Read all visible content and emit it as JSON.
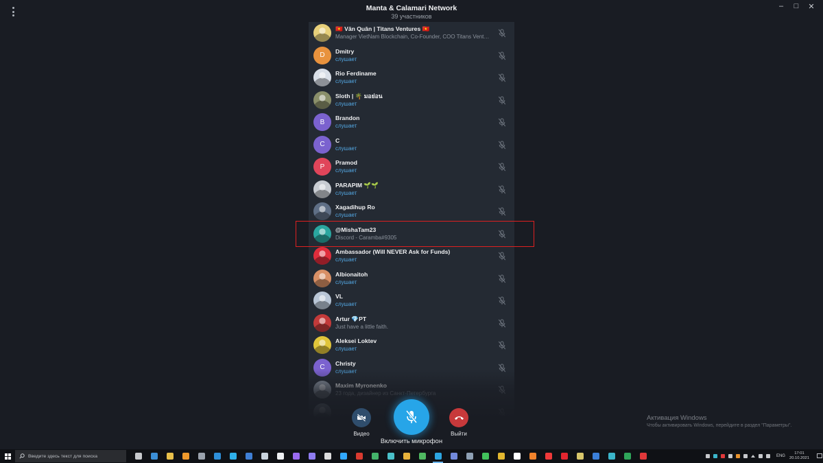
{
  "window": {
    "title": "Manta & Calamari Network",
    "subtitle": "39 участников",
    "controls": {
      "minimize": "–",
      "maximize": "□",
      "close": "✕"
    }
  },
  "participants": [
    {
      "name": "🇻🇳 Văn Quân | Titans Ventures 🇻🇳",
      "status": "Manager VietNam Blockchain, Co-Founder, COO Titans Ventures",
      "status_type": "about",
      "avatar_color": "#e7d07a",
      "avatar_letter": "",
      "photo": true
    },
    {
      "name": "Dmitry",
      "status": "слушает",
      "status_type": "listen",
      "avatar_color": "#e8923d",
      "avatar_letter": "D",
      "photo": false
    },
    {
      "name": "Rio Ferdiname",
      "status": "слушает",
      "status_type": "listen",
      "avatar_color": "#d9dfe8",
      "avatar_letter": "",
      "photo": true
    },
    {
      "name": "Sloth | 🌴 มอย่อน",
      "status": "слушает",
      "status_type": "listen",
      "avatar_color": "#8a8f6a",
      "avatar_letter": "",
      "photo": true
    },
    {
      "name": "Brandon",
      "status": "слушает",
      "status_type": "listen",
      "avatar_color": "#7b62cf",
      "avatar_letter": "B",
      "photo": false
    },
    {
      "name": "C",
      "status": "слушает",
      "status_type": "listen",
      "avatar_color": "#7b62cf",
      "avatar_letter": "C",
      "photo": false
    },
    {
      "name": "Pramod",
      "status": "слушает",
      "status_type": "listen",
      "avatar_color": "#e0455a",
      "avatar_letter": "P",
      "photo": false
    },
    {
      "name": "PARAPIM 🌱🌱",
      "status": "слушает",
      "status_type": "listen",
      "avatar_color": "#c8ccd2",
      "avatar_letter": "",
      "photo": true
    },
    {
      "name": "Xagadihup Ro",
      "status": "слушает",
      "status_type": "listen",
      "avatar_color": "#5f6f86",
      "avatar_letter": "",
      "photo": true
    },
    {
      "name": "@MishaTam23",
      "status": "Discord - Caramba#9305",
      "status_type": "about",
      "avatar_color": "#2aa7a0",
      "avatar_letter": "",
      "photo": true
    },
    {
      "name": "Ambassador (Will NEVER Ask for Funds)",
      "status": "слушает",
      "status_type": "listen",
      "avatar_color": "#e02d3c",
      "avatar_letter": "",
      "photo": true
    },
    {
      "name": "Albionaitoh",
      "status": "слушает",
      "status_type": "listen",
      "avatar_color": "#d89066",
      "avatar_letter": "",
      "photo": true
    },
    {
      "name": "VL",
      "status": "слушает",
      "status_type": "listen",
      "avatar_color": "#b9c6d6",
      "avatar_letter": "",
      "photo": true
    },
    {
      "name": "Artur 💎PT",
      "status": "Just have a little faith.",
      "status_type": "about",
      "avatar_color": "#c33a3a",
      "avatar_letter": "",
      "photo": true
    },
    {
      "name": "Aleksei Loktev",
      "status": "слушает",
      "status_type": "listen",
      "avatar_color": "#e0c53a",
      "avatar_letter": "",
      "photo": true
    },
    {
      "name": "Christy",
      "status": "слушает",
      "status_type": "listen",
      "avatar_color": "#7b62cf",
      "avatar_letter": "C",
      "photo": false
    },
    {
      "name": "Maxim Myronenko",
      "status": "23 года, дизайнер из Санкт-Петербурга",
      "status_type": "about",
      "avatar_color": "#8d96a3",
      "avatar_letter": "",
      "photo": true
    },
    {
      "name": "",
      "status": "",
      "status_type": "about",
      "avatar_color": "#6f7884",
      "avatar_letter": "",
      "photo": true
    }
  ],
  "controls": {
    "video_label": "Видео",
    "mic_label": "Включить микрофон",
    "leave_label": "Выйти",
    "video_color": "#2f4d6c",
    "mic_color": "#27a5e8",
    "leave_color": "#c7393b"
  },
  "watermark": {
    "line1": "Активация Windows",
    "line2": "Чтобы активировать Windows, перейдите в раздел \"Параметры\"."
  },
  "taskbar": {
    "search_placeholder": "Введите здесь текст для поиска",
    "apps": [
      {
        "icon": "task-view-icon",
        "color": "#c7c9cc"
      },
      {
        "icon": "mail-icon",
        "color": "#3b8fd6"
      },
      {
        "icon": "file-explorer-icon",
        "color": "#e8c04a"
      },
      {
        "icon": "lightning-app-icon",
        "color": "#f09a2c"
      },
      {
        "icon": "calculator-icon",
        "color": "#9aa2ac"
      },
      {
        "icon": "edge-legacy-icon",
        "color": "#2e8fd8"
      },
      {
        "icon": "skype-icon",
        "color": "#2fb0ea"
      },
      {
        "icon": "save-app-icon",
        "color": "#3f7fd4"
      },
      {
        "icon": "sphere-app-icon",
        "color": "#c9d3dc"
      },
      {
        "icon": "capcut-icon",
        "color": "#eef0f2"
      },
      {
        "icon": "premiere-icon",
        "color": "#9b6bf0"
      },
      {
        "icon": "after-effects-icon",
        "color": "#8f7cf0"
      },
      {
        "icon": "ball-app-icon",
        "color": "#dcdcdc"
      },
      {
        "icon": "photoshop-icon",
        "color": "#31a8ff"
      },
      {
        "icon": "filezilla-icon",
        "color": "#d83a2f"
      },
      {
        "icon": "map-app-icon",
        "color": "#44b36a"
      },
      {
        "icon": "pen-app-icon",
        "color": "#4ac0c8"
      },
      {
        "icon": "sketch-app-icon",
        "color": "#e8b23b"
      },
      {
        "icon": "network-app-icon",
        "color": "#4fb860"
      },
      {
        "icon": "telegram-icon",
        "color": "#2ca5e0"
      },
      {
        "icon": "discord-icon",
        "color": "#7289da"
      },
      {
        "icon": "cube-app-icon",
        "color": "#8ea0b3"
      },
      {
        "icon": "whatsapp-icon",
        "color": "#42c25b"
      },
      {
        "icon": "chrome-icon",
        "color": "#e2b72f"
      },
      {
        "icon": "yandex-icon",
        "color": "#ffffff"
      },
      {
        "icon": "firefox-icon",
        "color": "#f0832c"
      },
      {
        "icon": "vivaldi-icon",
        "color": "#ef3939"
      },
      {
        "icon": "opera-icon",
        "color": "#e3262f"
      },
      {
        "icon": "notes-app-icon",
        "color": "#d8c66a"
      },
      {
        "icon": "word-icon",
        "color": "#3b7fd8"
      },
      {
        "icon": "edge-icon",
        "color": "#3bb5c9"
      },
      {
        "icon": "excel-icon",
        "color": "#2fa65a"
      },
      {
        "icon": "record-app-icon",
        "color": "#e0383a"
      }
    ],
    "active_app": "telegram-icon",
    "lang": "ENG",
    "time": "17:01",
    "date": "20.10.2021"
  }
}
